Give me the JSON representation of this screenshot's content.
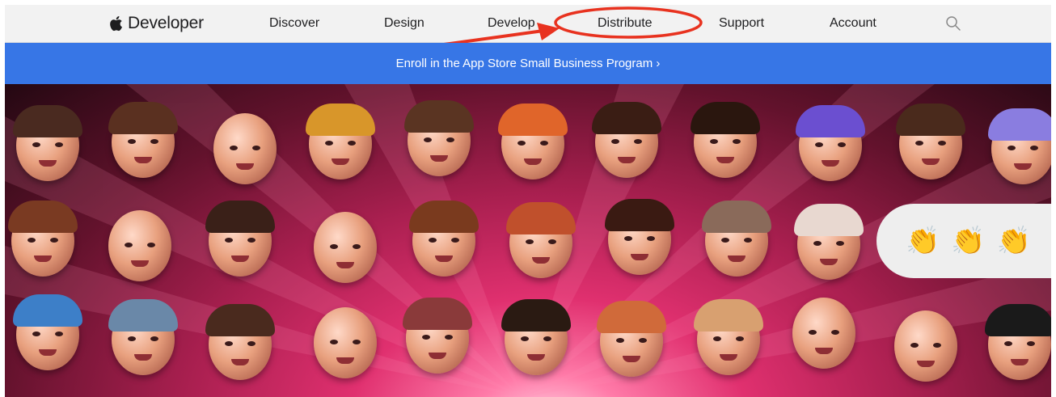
{
  "nav": {
    "logo_text": "Developer",
    "items": [
      "Discover",
      "Design",
      "Develop",
      "Distribute",
      "Support",
      "Account"
    ],
    "search_icon": "search-icon"
  },
  "banner": {
    "text": "Enroll in the App Store Small Business Program ›"
  },
  "hero": {
    "bubble_emojis": [
      "👏",
      "👏",
      "👏"
    ]
  },
  "colors": {
    "nav_bg": "#f2f2f2",
    "banner_bg": "#3776e6",
    "annotation": "#e8321f"
  }
}
